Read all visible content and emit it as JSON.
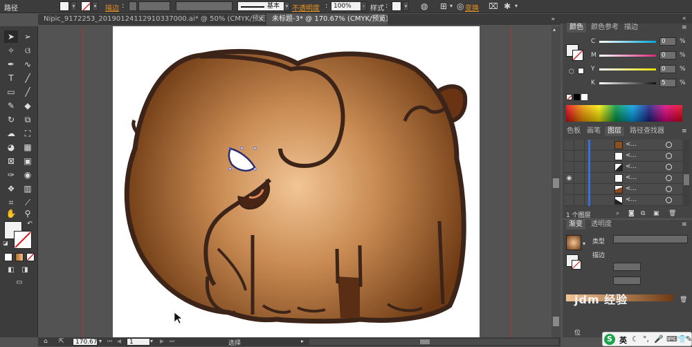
{
  "control_bar": {
    "object_type": "路径",
    "stroke_label": "描边",
    "stroke_style": "基本",
    "opacity_label": "不透明度",
    "opacity_value": "100%",
    "style_label": "样式",
    "transform_label": "变换"
  },
  "document_tabs": [
    {
      "label": "Nipic_9172253_20190124112910337000.ai* @ 50% (CMYK/预览)",
      "close": "×"
    },
    {
      "label": "未标题-3* @ 170.67% (CMYK/预览)",
      "close": "×"
    }
  ],
  "color_panel": {
    "tabs": [
      "颜色",
      "颜色参考",
      "描边"
    ],
    "channels": [
      {
        "label": "C",
        "value": "0"
      },
      {
        "label": "M",
        "value": "0"
      },
      {
        "label": "Y",
        "value": "0"
      },
      {
        "label": "K",
        "value": "5"
      }
    ],
    "channel_colors": [
      "#00a8d8",
      "#d8287a",
      "#e8e000",
      "#111111"
    ]
  },
  "layers_panel": {
    "tabs": [
      "色板",
      "画笔",
      "图层",
      "路径查找器"
    ],
    "rows": [
      {
        "name": "<..."
      },
      {
        "name": "<..."
      },
      {
        "name": "<..."
      },
      {
        "name": "<..."
      },
      {
        "name": "<..."
      },
      {
        "name": "<..."
      }
    ],
    "layer_count": "1 个图层"
  },
  "gradient_panel": {
    "tabs": [
      "渐变",
      "透明度"
    ],
    "type_label": "类型",
    "stroke_label": "描边",
    "location_label": "位"
  },
  "status_bar": {
    "zoom": "170.67",
    "page": "1",
    "tool_label": "选择"
  },
  "taskbar": {
    "ime": "英"
  },
  "watermark": "jdm 经验",
  "colors": {
    "ui_dark": "#3c3c3c",
    "ui_mid": "#535353",
    "accent_orange": "#e8901e",
    "elephant_light": "#f2c595",
    "elephant_dark": "#6e3a14",
    "outline": "#3d2418"
  }
}
